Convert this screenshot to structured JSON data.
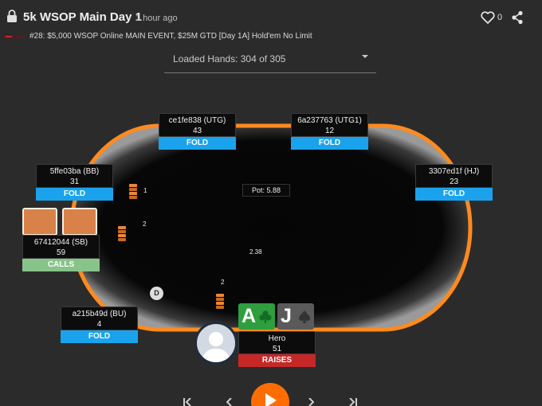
{
  "header": {
    "title": "5k WSOP Main Day 1",
    "time_ago": "1 hour ago",
    "likes": "0",
    "subtitle": "#28: $5,000 WSOP Online MAIN EVENT, $25M GTD [Day 1A] Hold'em No Limit"
  },
  "hands_select": {
    "label": "Loaded Hands: 304 of 305"
  },
  "table": {
    "pot": "Pot: 5.88",
    "center_bet": "2.38"
  },
  "seats": {
    "utg": {
      "name": "ce1fe838 (UTG)",
      "stack": "43",
      "action": "FOLD"
    },
    "utg1": {
      "name": "6a237763 (UTG1)",
      "stack": "12",
      "action": "FOLD"
    },
    "hj": {
      "name": "3307ed1f (HJ)",
      "stack": "23",
      "action": "FOLD"
    },
    "bb": {
      "name": "5ffe03ba (BB)",
      "stack": "31",
      "action": "FOLD"
    },
    "sb": {
      "name": "67412044 (SB)",
      "stack": "59",
      "action": "CALLS"
    },
    "bu": {
      "name": "a215b49d (BU)",
      "stack": "4",
      "action": "FOLD"
    },
    "hero": {
      "name": "Hero",
      "stack": "51",
      "action": "RAISES"
    }
  },
  "bets": {
    "bb": "1",
    "sb": "2",
    "hero": "2"
  },
  "dealer_button": "D",
  "hero_cards": [
    {
      "rank": "A",
      "suit": "club-icon",
      "color": "#2e9e3e"
    },
    {
      "rank": "J",
      "suit": "spade-icon",
      "color": "#5a5a5a"
    }
  ],
  "colors": {
    "background": "#2b2b2b",
    "rail": "#ff8a1f",
    "fold": "#1aa3ec",
    "calls": "#88c48a",
    "raises": "#c62828",
    "play": "#ff6d00"
  },
  "controls": {
    "first": "first-hand-icon",
    "prev": "previous-icon",
    "play": "play-icon",
    "next": "next-icon",
    "last": "last-hand-icon"
  }
}
